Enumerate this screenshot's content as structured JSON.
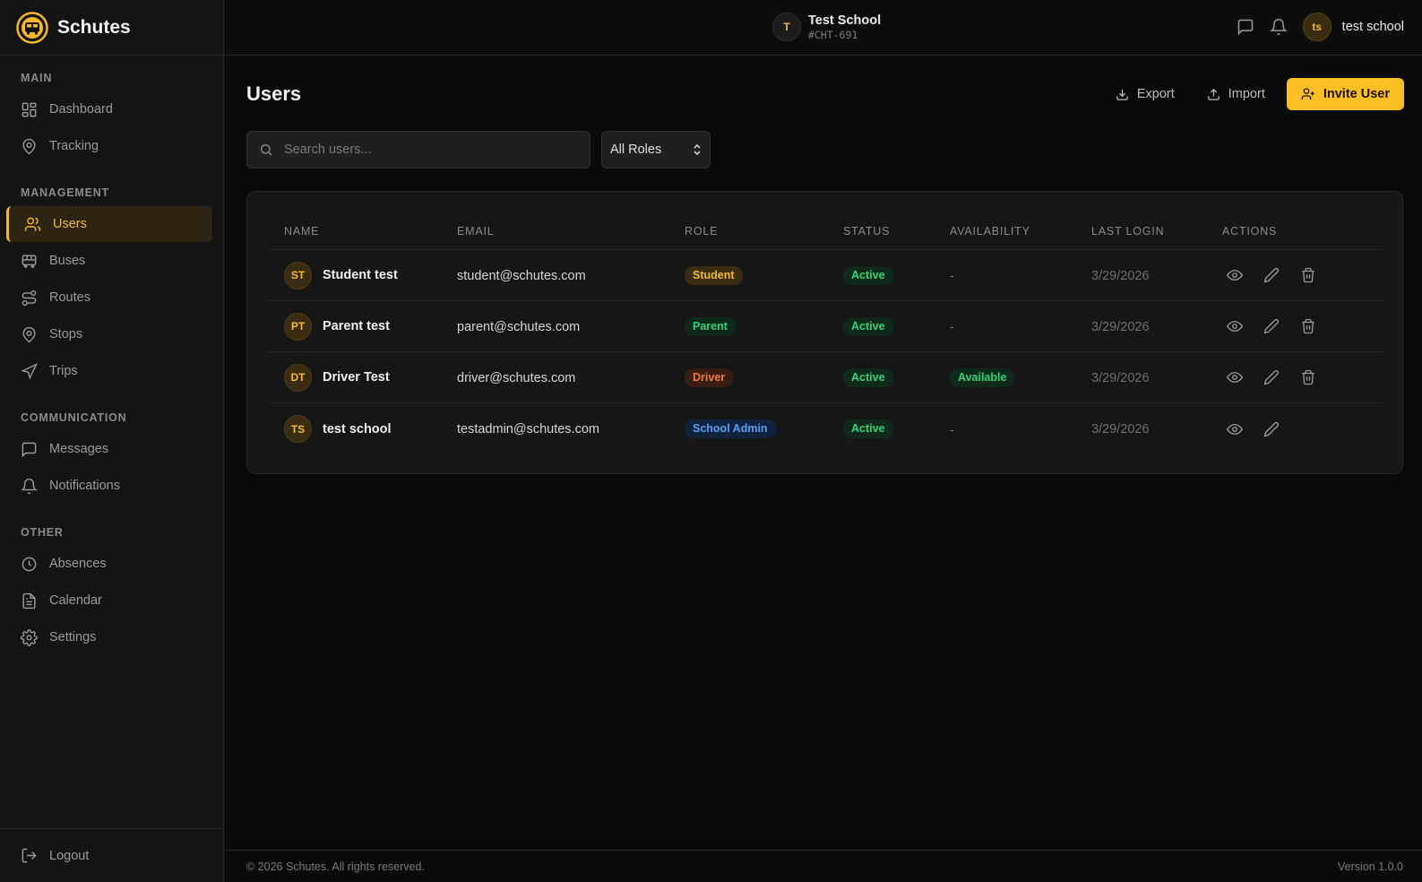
{
  "brand": {
    "name": "Schutes",
    "accent": "#fbbf24"
  },
  "sidebar": {
    "sections": [
      {
        "label": "MAIN"
      },
      {
        "label": "MANAGEMENT"
      },
      {
        "label": "COMMUNICATION"
      },
      {
        "label": "OTHER"
      }
    ],
    "items": [
      {
        "label": "Dashboard",
        "icon": "dashboard-icon"
      },
      {
        "label": "Tracking",
        "icon": "map-pin-icon"
      },
      {
        "label": "Users",
        "icon": "users-icon",
        "active": true
      },
      {
        "label": "Buses",
        "icon": "bus-icon"
      },
      {
        "label": "Routes",
        "icon": "route-icon"
      },
      {
        "label": "Stops",
        "icon": "map-pin-icon"
      },
      {
        "label": "Trips",
        "icon": "navigation-icon"
      },
      {
        "label": "Messages",
        "icon": "message-icon"
      },
      {
        "label": "Notifications",
        "icon": "bell-icon"
      },
      {
        "label": "Absences",
        "icon": "clock-icon"
      },
      {
        "label": "Calendar",
        "icon": "file-text-icon"
      },
      {
        "label": "Settings",
        "icon": "gear-icon"
      }
    ],
    "logout": "Logout"
  },
  "topbar": {
    "school_initial": "T",
    "school_name": "Test School",
    "school_code": "#CHT-691",
    "user_initials": "ts",
    "user_name": "test school"
  },
  "main": {
    "title": "Users",
    "export_label": "Export",
    "import_label": "Import",
    "invite_label": "Invite User",
    "search_placeholder": "Search users...",
    "role_filter": "All Roles"
  },
  "table": {
    "headers": [
      "NAME",
      "EMAIL",
      "ROLE",
      "STATUS",
      "AVAILABILITY",
      "LAST LOGIN",
      "ACTIONS"
    ],
    "rows": [
      {
        "initials": "ST",
        "name": "Student test",
        "email": "student@schutes.com",
        "role": "Student",
        "role_kind": "student",
        "status": "Active",
        "availability": "-",
        "last_login": "3/29/2026",
        "can_delete": true
      },
      {
        "initials": "PT",
        "name": "Parent test",
        "email": "parent@schutes.com",
        "role": "Parent",
        "role_kind": "parent",
        "status": "Active",
        "availability": "-",
        "last_login": "3/29/2026",
        "can_delete": true
      },
      {
        "initials": "DT",
        "name": "Driver Test",
        "email": "driver@schutes.com",
        "role": "Driver",
        "role_kind": "driver",
        "status": "Active",
        "availability": "Available",
        "last_login": "3/29/2026",
        "can_delete": true
      },
      {
        "initials": "TS",
        "name": "test school",
        "email": "testadmin@schutes.com",
        "role": "School Admin",
        "role_kind": "admin",
        "status": "Active",
        "availability": "-",
        "last_login": "3/29/2026",
        "can_delete": false
      }
    ]
  },
  "footer": {
    "copyright": "© 2026 Schutes. All rights reserved.",
    "version": "Version 1.0.0"
  }
}
